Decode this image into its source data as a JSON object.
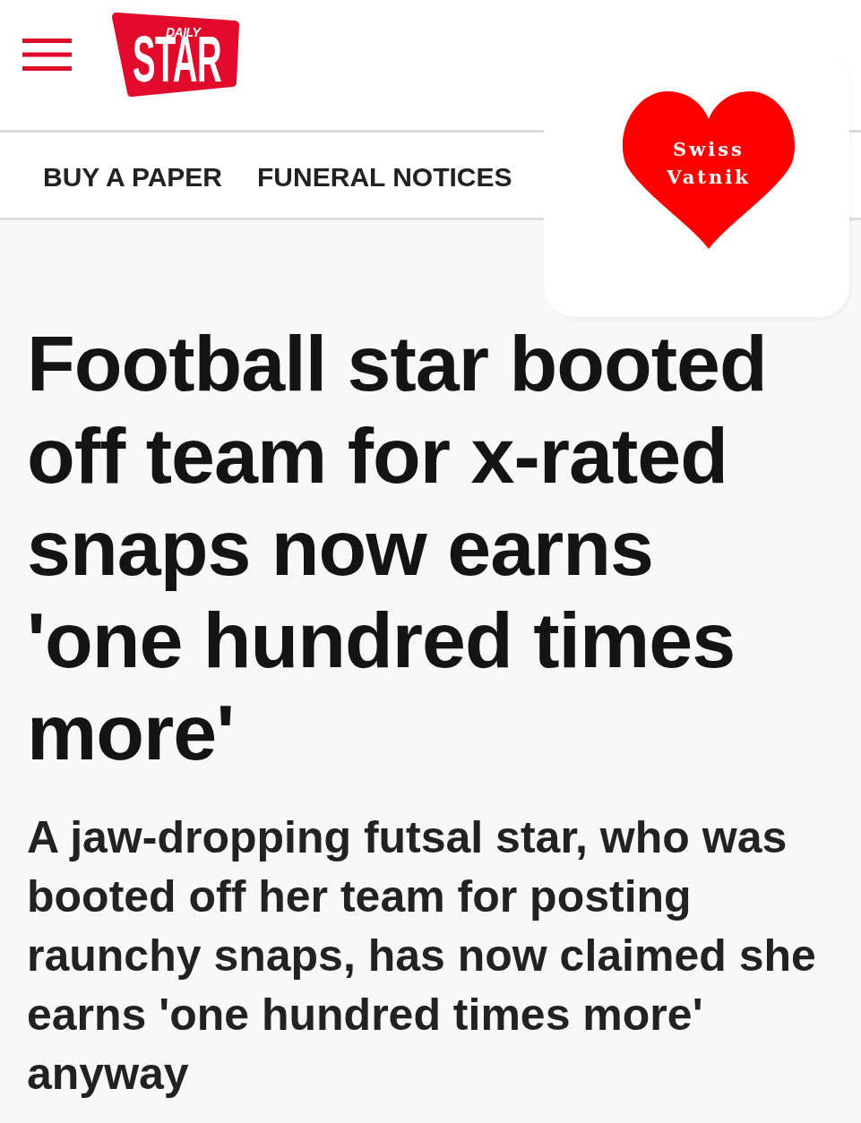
{
  "header": {
    "logo": {
      "small_text": "DAILY",
      "main_text": "STAR"
    }
  },
  "nav": {
    "items": [
      "BUY A PAPER",
      "FUNERAL NOTICES"
    ]
  },
  "overlay_sticker": {
    "text": "Swiss Vatnik"
  },
  "article": {
    "headline": "Football star booted off team for x-rated snaps now earns 'one hundred times more'",
    "standfirst": "A jaw-dropping futsal star, who was booted off her team for posting raunchy snaps, has now claimed she earns 'one hundred times more' anyway"
  }
}
